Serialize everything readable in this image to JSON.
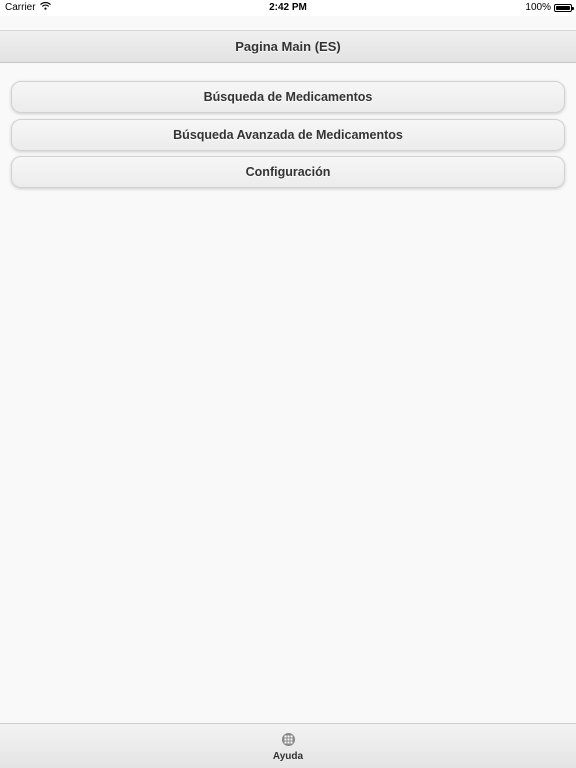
{
  "status_bar": {
    "carrier": "Carrier",
    "time": "2:42 PM",
    "battery": "100%",
    "battery_level": 1.0,
    "wifi_icon": "wifi-icon",
    "battery_icon": "battery-icon"
  },
  "header": {
    "title": "Pagina Main (ES)"
  },
  "menu": {
    "items": [
      {
        "label": "Búsqueda de Medicamentos"
      },
      {
        "label": "Búsqueda Avanzada de Medicamentos"
      },
      {
        "label": "Configuración"
      }
    ]
  },
  "footer": {
    "tab_label": "Ayuda",
    "tab_icon": "grid-icon"
  },
  "colors": {
    "background": "#f9f9f9",
    "bar": "#e9e9e9",
    "text": "#333333"
  }
}
